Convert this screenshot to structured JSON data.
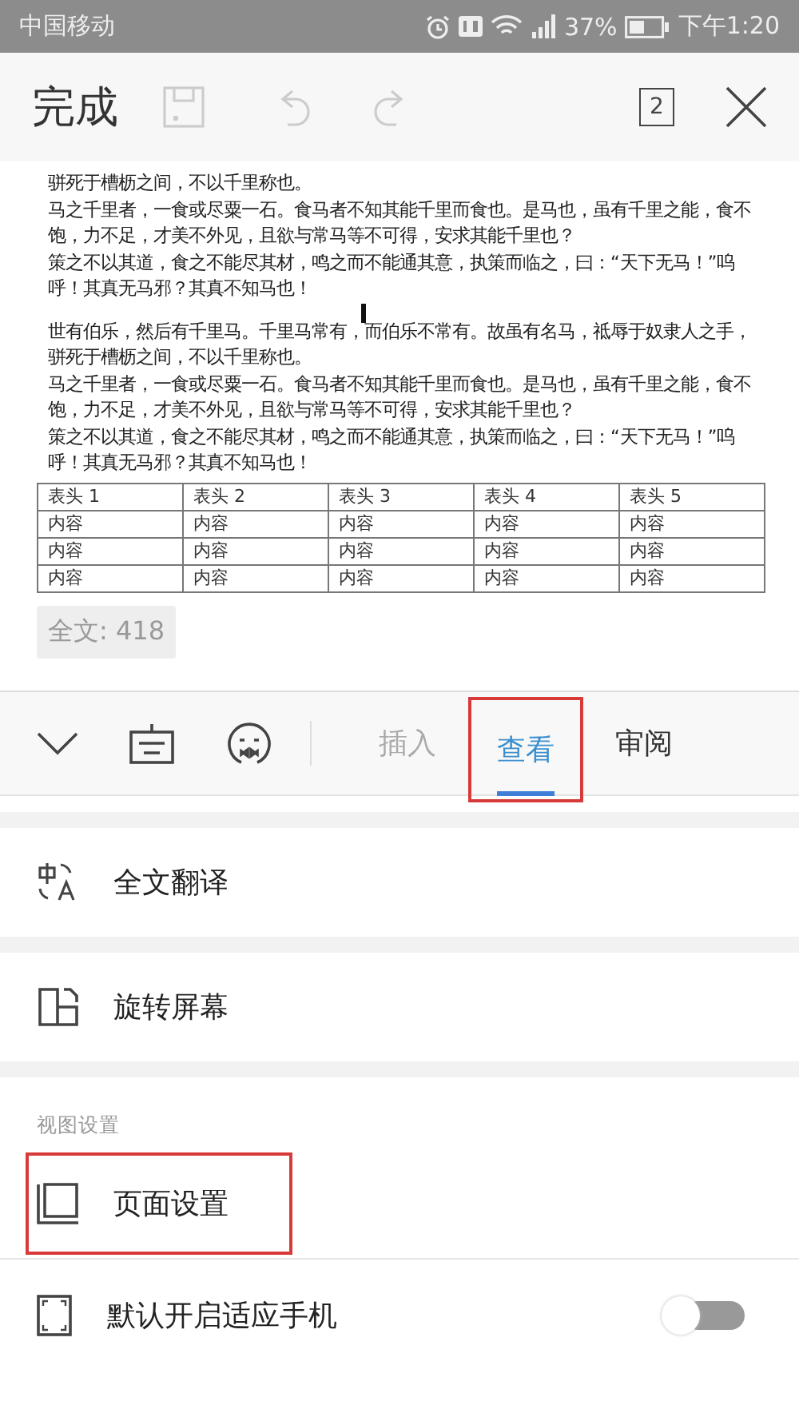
{
  "status_bar": {
    "carrier": "中国移动",
    "battery": "37%",
    "time": "下午1:20"
  },
  "toolbar": {
    "done": "完成",
    "undo_disabled": true,
    "redo_disabled": true,
    "save_disabled": true,
    "page_count": "2"
  },
  "document": {
    "paragraphs": [
      "骈死于槽枥之间，不以千里称也。",
      "马之千里者，一食或尽粟一石。食马者不知其能千里而食也。是马也，虽有千里之能，食不饱，力不足，才美不外见，且欲与常马等不可得，安求其能千里也？",
      "策之不以其道，食之不能尽其材，鸣之而不能通其意，执策而临之，曰：“天下无马！”呜呼！其真无马邪？其真不知马也！",
      " 世有伯乐，然后有千里马。千里马常有，而伯乐不常有。故虽有名马，祗辱于奴隶人之手，骈死于槽枥之间，不以千里称也。",
      "马之千里者，一食或尽粟一石。食马者不知其能千里而食也。是马也，虽有千里之能，食不饱，力不足，才美不外见，且欲与常马等不可得，安求其能千里也？",
      "策之不以其道，食之不能尽其材，鸣之而不能通其意，执策而临之，曰：“天下无马！”呜呼！其真无马邪？其真不知马也！"
    ],
    "table": {
      "columns": [
        "表头 1",
        "表头 2",
        "表头 3",
        "表头 4",
        "表头 5"
      ],
      "rows": [
        [
          "内容",
          "内容",
          "内容",
          "内容",
          "内容"
        ],
        [
          "内容",
          "内容",
          "内容",
          "内容",
          "内容"
        ],
        [
          "内容",
          "内容",
          "内容",
          "内容",
          "内容"
        ]
      ]
    },
    "word_count": "全文: 418"
  },
  "tabs": [
    {
      "label": "插入",
      "selected": false,
      "highlighted": false
    },
    {
      "label": "查看",
      "selected": true,
      "highlighted": true
    },
    {
      "label": "审阅",
      "selected": false,
      "highlighted": false
    }
  ],
  "menu": [
    {
      "kind": "item",
      "label": "全文翻译",
      "highlighted": false
    },
    {
      "kind": "gap"
    },
    {
      "kind": "item",
      "label": "旋转屏幕",
      "highlighted": false
    },
    {
      "kind": "gap"
    },
    {
      "kind": "header",
      "label": "视图设置"
    },
    {
      "kind": "item",
      "label": "页面设置",
      "highlighted": true
    },
    {
      "kind": "toggle",
      "label": "默认开启适应手机",
      "on": false
    }
  ]
}
